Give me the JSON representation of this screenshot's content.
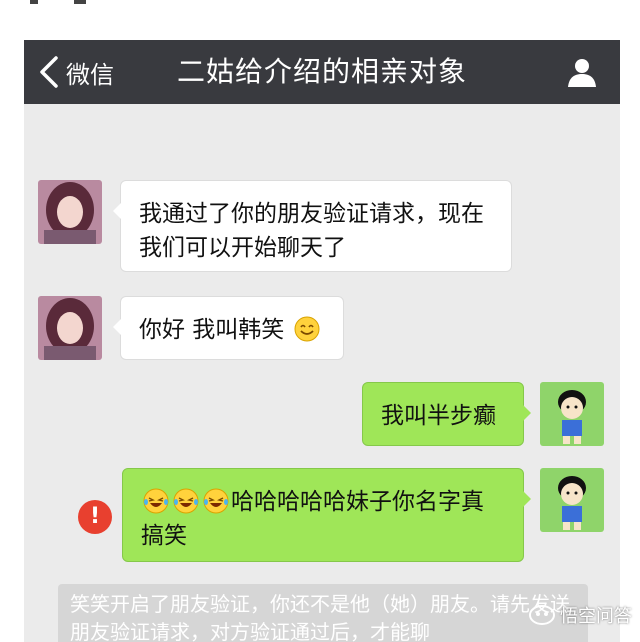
{
  "header": {
    "back_label": "微信",
    "title": "二姑给介绍的相亲对象"
  },
  "messages": [
    {
      "side": "in",
      "text": "我通过了你的朋友验证请求，现在我们可以开始聊天了"
    },
    {
      "side": "in",
      "text": "你好 我叫韩笑",
      "emoji": "smile-emoji"
    },
    {
      "side": "out",
      "text": "我叫半步癫"
    },
    {
      "side": "out",
      "emoji": "laughing-tears-emoji x3",
      "text": "哈哈哈哈哈妹子你名字真搞笑",
      "status": "failed"
    }
  ],
  "system_notice": "笑笑开启了朋友验证，你还不是他（她）朋友。请先发送朋友验证请求，对方验证通过后，才能聊",
  "watermark": "悟空问答",
  "colors": {
    "titlebar": "#393a3f",
    "chat_bg": "#ebebeb",
    "outgoing_bubble": "#9fe658",
    "incoming_bubble": "#ffffff",
    "error": "#e8402f"
  }
}
